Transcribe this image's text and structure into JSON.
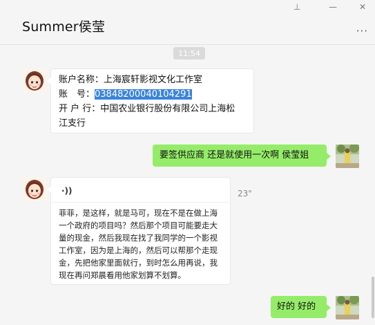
{
  "window": {
    "title": "Summer侯莹",
    "pin_glyph": "⊥",
    "minimize_glyph": "—",
    "close_glyph": "✕",
    "more_glyph": "···"
  },
  "chat": {
    "timestamp": "11:54",
    "messages": [
      {
        "from": "contact",
        "account_name_line": "账户名称：上海宸轩影视文化工作室",
        "account_no_label": "账　号：",
        "account_no_value": "03848200040104291",
        "bank_line1": "开 户 行：中国农业银行股份有限公司上海松",
        "bank_line2": "江支行"
      },
      {
        "from": "me",
        "text": "要签供应商 还是就使用一次啊  侯莹姐"
      },
      {
        "from": "contact",
        "type": "voice",
        "voice_icon": "·))",
        "duration": "23\"",
        "transcript": "菲菲，是这样，就是马可，现在不是在做上海一个政府的项目吗？然后那个项目可能要走大量的现金，然后我现在找了我同学的一个影视工作室，因为是上海的，然后可以帮那个走现金，先把他家里面就行，到时怎么用再说，我现在再问郑晨看用他家划算不划算。"
      },
      {
        "from": "me",
        "text": "好的 好的"
      }
    ]
  }
}
